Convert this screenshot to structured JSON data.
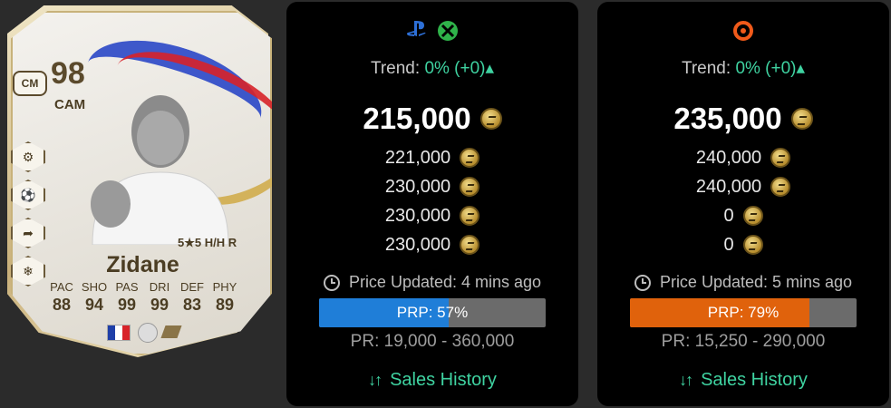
{
  "card": {
    "rating": "98",
    "position": "CM",
    "alt_position": "CAM",
    "skill_moves": "5★5 H/H R",
    "name": "Zidane",
    "stat_labels": [
      "PAC",
      "SHO",
      "PAS",
      "DRI",
      "DEF",
      "PHY"
    ],
    "stat_values": [
      "88",
      "94",
      "99",
      "99",
      "83",
      "89"
    ],
    "flag_colors": [
      "#1f3fa8",
      "#ffffff",
      "#d8232a"
    ]
  },
  "panels": [
    {
      "platform_icons": [
        "playstation-icon",
        "xbox-icon"
      ],
      "trend_label": "Trend:",
      "trend_value": "0% (+0)",
      "trend_arrow": "▴",
      "main_price": "215,000",
      "prices": [
        "221,000",
        "230,000",
        "230,000",
        "230,000"
      ],
      "updated": "Price Updated: 4 mins ago",
      "prp": "PRP: 57%",
      "prp_fraction": 0.57,
      "prp_color": "#1f7ed8",
      "pr_range": "PR: 19,000 - 360,000",
      "sales_history": "Sales History"
    },
    {
      "platform_icons": [
        "origin-icon"
      ],
      "trend_label": "Trend:",
      "trend_value": "0% (+0)",
      "trend_arrow": "▴",
      "main_price": "235,000",
      "prices": [
        "240,000",
        "240,000",
        "0",
        "0"
      ],
      "updated": "Price Updated: 5 mins ago",
      "prp": "PRP: 79%",
      "prp_fraction": 0.79,
      "prp_color": "#e0620c",
      "pr_range": "PR: 15,250 - 290,000",
      "sales_history": "Sales History"
    }
  ],
  "colors": {
    "accent_green": "#3fd3a1",
    "panel_bg": "#000000",
    "page_bg": "#2b2b2b"
  }
}
